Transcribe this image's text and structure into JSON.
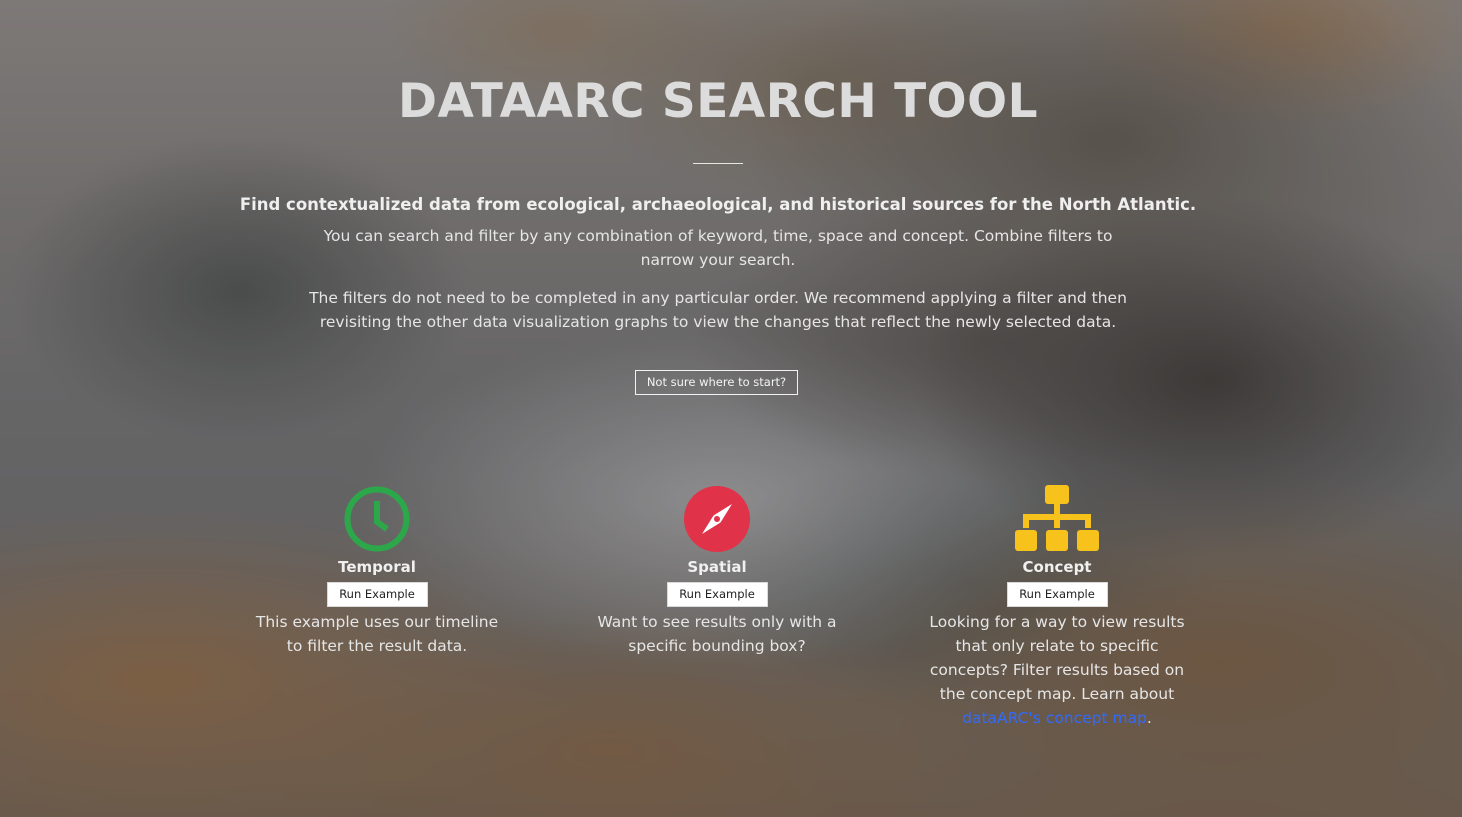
{
  "page": {
    "title": "DATAARC SEARCH TOOL",
    "lead": "Find contextualized data from ecological, archaeological, and historical sources for the North Atlantic.",
    "paragraph_1": "You can search and filter by any combination of keyword, time, space and concept. Combine filters to narrow your search.",
    "paragraph_2": "The filters do not need to be completed in any particular order. We recommend applying a filter and then revisiting the other data visualization graphs to view the changes that reflect the newly selected data.",
    "start_button": "Not sure where to start?"
  },
  "examples": [
    {
      "title": "Temporal",
      "icon": "clock-icon",
      "color": "#2ca84a",
      "button": "Run Example",
      "description": "This example uses our timeline to filter the result data."
    },
    {
      "title": "Spatial",
      "icon": "compass-icon",
      "color": "#e0334a",
      "button": "Run Example",
      "description": "Want to see results only with a specific bounding box?"
    },
    {
      "title": "Concept",
      "icon": "sitemap-icon",
      "color": "#f7c21b",
      "button": "Run Example",
      "description": "Looking for a way to view results that only relate to specific concepts? Filter results based on the concept map.",
      "learn_prefix": "Learn about ",
      "learn_link": "dataARC's concept map",
      "learn_suffix": "."
    }
  ],
  "colors": {
    "link": "#2f6bff",
    "title_text": "#dcdcdc"
  }
}
